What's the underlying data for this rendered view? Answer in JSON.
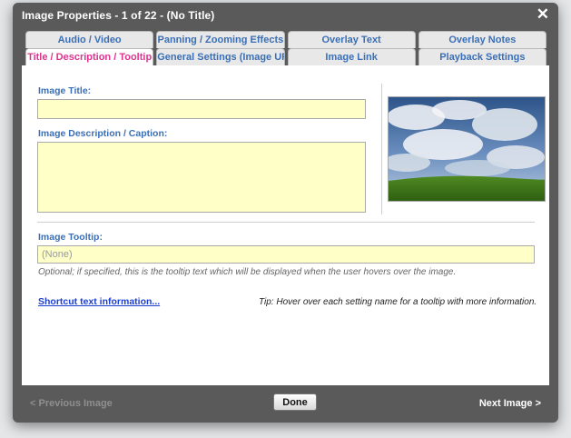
{
  "dialog": {
    "title": "Image Properties - 1 of 22 - (No Title)",
    "close_label": "✕"
  },
  "tabs": {
    "row1": [
      "Audio / Video",
      "Panning / Zooming Effects",
      "Overlay Text",
      "Overlay Notes"
    ],
    "row2": [
      "Title / Description / Tooltip",
      "General Settings (Image URLs)",
      "Image Link",
      "Playback Settings"
    ],
    "active": "Title / Description / Tooltip"
  },
  "form": {
    "image_title_label": "Image Title:",
    "image_title_value": "",
    "image_description_label": "Image Description / Caption:",
    "image_description_value": "",
    "image_tooltip_label": "Image Tooltip:",
    "image_tooltip_placeholder": "(None)",
    "image_tooltip_hint": "Optional; if specified, this is the tooltip text which will be displayed when the user hovers over the image."
  },
  "links": {
    "shortcut_text": "Shortcut text information..."
  },
  "tip": "Tip: Hover over each setting name for a tooltip with more information.",
  "footer": {
    "previous_label": "< Previous Image",
    "done_label": "Done",
    "next_label": "Next Image >"
  },
  "colors": {
    "tab_text": "#3a6fb6",
    "active_tab_text": "#e0338f",
    "field_bg": "#ffffc8",
    "dialog_frame": "#5a5a5a"
  }
}
